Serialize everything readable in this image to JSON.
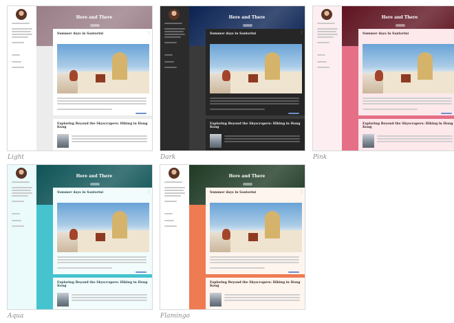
{
  "themes": [
    {
      "caption": "Light",
      "blog_title": "Here and There",
      "post1_title": "Summer days in Santorini",
      "post2_title": "Exploring Beyond the Skyscrapers: Hiking in Hong Kong",
      "colors": {
        "hero": "#9a7e87",
        "sidebar": "#ffffff",
        "main": "#ececec",
        "card": "#ffffff",
        "title": "#ffffff",
        "text": "#333333"
      }
    },
    {
      "caption": "Dark",
      "blog_title": "Here and There",
      "post1_title": "Summer days in Santorini",
      "post2_title": "Exploring Beyond the Skyscrapers: Hiking in Hong Kong",
      "colors": {
        "hero": "#0b2353",
        "sidebar": "#2b2b2b",
        "main": "#3a3a3a",
        "card": "#262626",
        "title": "#ffffff",
        "text": "#eeeeee"
      }
    },
    {
      "caption": "Pink",
      "blog_title": "Here and There",
      "post1_title": "Summer days in Santorini",
      "post2_title": "Exploring Beyond the Skyscrapers: Hiking in Hong Kong",
      "colors": {
        "hero": "#5e1320",
        "sidebar": "#fdeff1",
        "main": "#e46f86",
        "card": "#fde8ec",
        "title": "#ffffff",
        "text": "#3a2a2c"
      }
    },
    {
      "caption": "Aqua",
      "blog_title": "Here and There",
      "post1_title": "Summer days in Santorini",
      "post2_title": "Exploring Beyond the Skyscrapers: Hiking in Hong Kong",
      "colors": {
        "hero": "#0f5457",
        "sidebar": "#ebfafb",
        "main": "#45c3cf",
        "card": "#f2fcfd",
        "title": "#ffffff",
        "text": "#28484a"
      }
    },
    {
      "caption": "Flamingo",
      "blog_title": "Here and There",
      "post1_title": "Summer days in Santorini",
      "post2_title": "Exploring Beyond the Skyscrapers: Hiking in Hong Kong",
      "colors": {
        "hero": "#1f3a25",
        "sidebar": "#ffffff",
        "main": "#ee7b52",
        "card": "#fff5ef",
        "title": "#ffffff",
        "text": "#3a2a22"
      }
    }
  ]
}
